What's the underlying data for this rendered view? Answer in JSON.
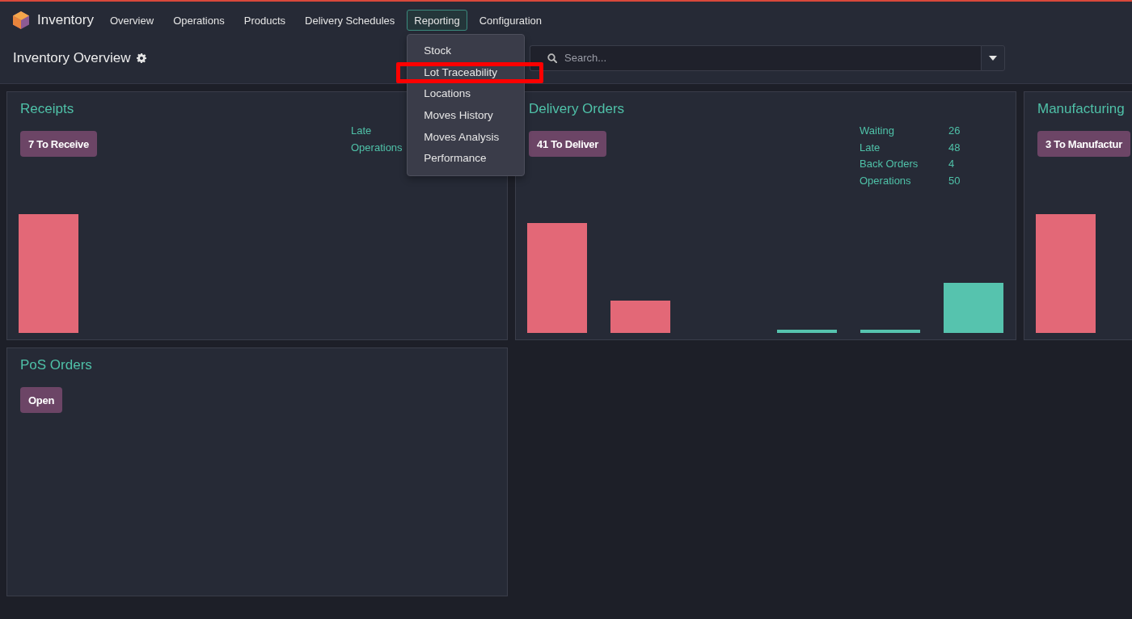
{
  "top_bar": {
    "app_name": "Inventory",
    "menu": [
      {
        "label": "Overview",
        "selected": false
      },
      {
        "label": "Operations",
        "selected": false
      },
      {
        "label": "Products",
        "selected": false
      },
      {
        "label": "Delivery Schedules",
        "selected": false
      },
      {
        "label": "Reporting",
        "selected": true,
        "submenu": [
          {
            "label": "Stock",
            "highlighted": false
          },
          {
            "label": "Lot Traceability",
            "highlighted": true
          },
          {
            "label": "Locations",
            "highlighted": false
          },
          {
            "label": "Moves History",
            "highlighted": false
          },
          {
            "label": "Moves Analysis",
            "highlighted": false
          },
          {
            "label": "Performance",
            "highlighted": false
          }
        ]
      },
      {
        "label": "Configuration",
        "selected": false
      }
    ]
  },
  "control_panel": {
    "title": "Inventory Overview",
    "search": {
      "placeholder": "Search..."
    }
  },
  "cards": [
    {
      "title": "Receipts",
      "kind": "graph",
      "action": "7 To Receive",
      "stats": [
        {
          "label": "Late"
        },
        {
          "label": "Operations"
        }
      ]
    },
    {
      "title": "Delivery Orders",
      "kind": "graph",
      "action": "41 To Deliver",
      "stats": [
        {
          "label": "Waiting",
          "value": "26"
        },
        {
          "label": "Late",
          "value": "48"
        },
        {
          "label": "Back Orders",
          "value": "4"
        },
        {
          "label": "Operations",
          "value": "50"
        }
      ]
    },
    {
      "title": "Manufacturing",
      "kind": "graph",
      "action": "3 To Manufactur"
    },
    {
      "title": "PoS Orders",
      "kind": "plain",
      "action": "Open"
    }
  ]
}
